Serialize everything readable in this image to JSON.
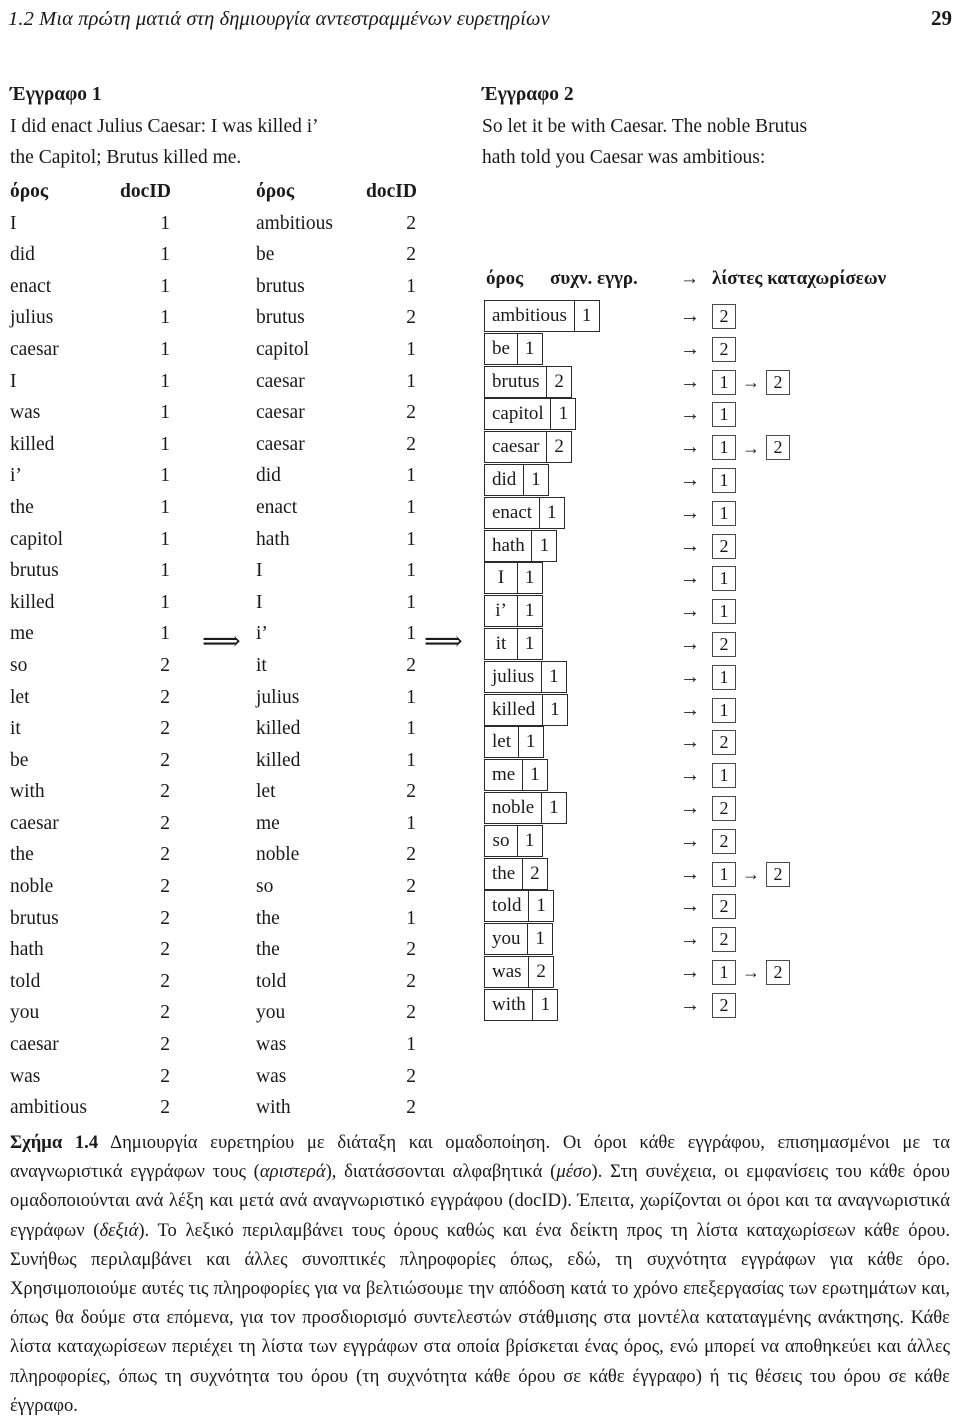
{
  "running_head": {
    "title": "1.2 Μια πρώτη ματιά στη δημιουργία αντεστραμμένων ευρετηρίων",
    "page_number": "29"
  },
  "documents": [
    {
      "title": "Έγγραφο 1",
      "line1": "I did enact Julius Caesar: I was killed i’",
      "line2": "the Capitol; Brutus killed me."
    },
    {
      "title": "Έγγραφο 2",
      "line1": "So let it be with Caesar. The noble Brutus",
      "line2": "hath told you Caesar was ambitious:"
    }
  ],
  "tables": {
    "headers": {
      "term": "όρος",
      "docid": "docID"
    },
    "unsorted": [
      {
        "term": "I",
        "docid": "1"
      },
      {
        "term": "did",
        "docid": "1"
      },
      {
        "term": "enact",
        "docid": "1"
      },
      {
        "term": "julius",
        "docid": "1"
      },
      {
        "term": "caesar",
        "docid": "1"
      },
      {
        "term": "I",
        "docid": "1"
      },
      {
        "term": "was",
        "docid": "1"
      },
      {
        "term": "killed",
        "docid": "1"
      },
      {
        "term": "i’",
        "docid": "1"
      },
      {
        "term": "the",
        "docid": "1"
      },
      {
        "term": "capitol",
        "docid": "1"
      },
      {
        "term": "brutus",
        "docid": "1"
      },
      {
        "term": "killed",
        "docid": "1"
      },
      {
        "term": "me",
        "docid": "1"
      },
      {
        "term": "so",
        "docid": "2"
      },
      {
        "term": "let",
        "docid": "2"
      },
      {
        "term": "it",
        "docid": "2"
      },
      {
        "term": "be",
        "docid": "2"
      },
      {
        "term": "with",
        "docid": "2"
      },
      {
        "term": "caesar",
        "docid": "2"
      },
      {
        "term": "the",
        "docid": "2"
      },
      {
        "term": "noble",
        "docid": "2"
      },
      {
        "term": "brutus",
        "docid": "2"
      },
      {
        "term": "hath",
        "docid": "2"
      },
      {
        "term": "told",
        "docid": "2"
      },
      {
        "term": "you",
        "docid": "2"
      },
      {
        "term": "caesar",
        "docid": "2"
      },
      {
        "term": "was",
        "docid": "2"
      },
      {
        "term": "ambitious",
        "docid": "2"
      }
    ],
    "sorted": [
      {
        "term": "ambitious",
        "docid": "2"
      },
      {
        "term": "be",
        "docid": "2"
      },
      {
        "term": "brutus",
        "docid": "1"
      },
      {
        "term": "brutus",
        "docid": "2"
      },
      {
        "term": "capitol",
        "docid": "1"
      },
      {
        "term": "caesar",
        "docid": "1"
      },
      {
        "term": "caesar",
        "docid": "2"
      },
      {
        "term": "caesar",
        "docid": "2"
      },
      {
        "term": "did",
        "docid": "1"
      },
      {
        "term": "enact",
        "docid": "1"
      },
      {
        "term": "hath",
        "docid": "1"
      },
      {
        "term": "I",
        "docid": "1"
      },
      {
        "term": "I",
        "docid": "1"
      },
      {
        "term": "i’",
        "docid": "1"
      },
      {
        "term": "it",
        "docid": "2"
      },
      {
        "term": "julius",
        "docid": "1"
      },
      {
        "term": "killed",
        "docid": "1"
      },
      {
        "term": "killed",
        "docid": "1"
      },
      {
        "term": "let",
        "docid": "2"
      },
      {
        "term": "me",
        "docid": "1"
      },
      {
        "term": "noble",
        "docid": "2"
      },
      {
        "term": "so",
        "docid": "2"
      },
      {
        "term": "the",
        "docid": "1"
      },
      {
        "term": "the",
        "docid": "2"
      },
      {
        "term": "told",
        "docid": "2"
      },
      {
        "term": "you",
        "docid": "2"
      },
      {
        "term": "was",
        "docid": "1"
      },
      {
        "term": "was",
        "docid": "2"
      },
      {
        "term": "with",
        "docid": "2"
      }
    ]
  },
  "arrows": {
    "double_arrow_glyph": "⟹",
    "single_arrow_glyph": "→"
  },
  "dictionary": {
    "headers": {
      "term": "όρος",
      "freq": "συχν. εγγρ.",
      "arrow": "→",
      "postings": "λίστες καταχωρίσεων"
    },
    "rows": [
      {
        "term": "ambitious",
        "freq": "1",
        "postings": [
          "2"
        ]
      },
      {
        "term": "be",
        "freq": "1",
        "postings": [
          "2"
        ]
      },
      {
        "term": "brutus",
        "freq": "2",
        "postings": [
          "1",
          "2"
        ]
      },
      {
        "term": "capitol",
        "freq": "1",
        "postings": [
          "1"
        ]
      },
      {
        "term": "caesar",
        "freq": "2",
        "postings": [
          "1",
          "2"
        ]
      },
      {
        "term": "did",
        "freq": "1",
        "postings": [
          "1"
        ]
      },
      {
        "term": "enact",
        "freq": "1",
        "postings": [
          "1"
        ]
      },
      {
        "term": "hath",
        "freq": "1",
        "postings": [
          "2"
        ]
      },
      {
        "term": "I",
        "freq": "1",
        "postings": [
          "1"
        ]
      },
      {
        "term": "i’",
        "freq": "1",
        "postings": [
          "1"
        ]
      },
      {
        "term": "it",
        "freq": "1",
        "postings": [
          "2"
        ]
      },
      {
        "term": "julius",
        "freq": "1",
        "postings": [
          "1"
        ]
      },
      {
        "term": "killed",
        "freq": "1",
        "postings": [
          "1"
        ]
      },
      {
        "term": "let",
        "freq": "1",
        "postings": [
          "2"
        ]
      },
      {
        "term": "me",
        "freq": "1",
        "postings": [
          "1"
        ]
      },
      {
        "term": "noble",
        "freq": "1",
        "postings": [
          "2"
        ]
      },
      {
        "term": "so",
        "freq": "1",
        "postings": [
          "2"
        ]
      },
      {
        "term": "the",
        "freq": "2",
        "postings": [
          "1",
          "2"
        ]
      },
      {
        "term": "told",
        "freq": "1",
        "postings": [
          "2"
        ]
      },
      {
        "term": "you",
        "freq": "1",
        "postings": [
          "2"
        ]
      },
      {
        "term": "was",
        "freq": "2",
        "postings": [
          "1",
          "2"
        ]
      },
      {
        "term": "with",
        "freq": "1",
        "postings": [
          "2"
        ]
      }
    ]
  },
  "caption": {
    "label": "Σχήμα 1.4",
    "parts": [
      {
        "text": "Δημιουργία ευρετηρίου με διάταξη και ομαδοποίηση. Οι όροι κάθε εγγράφου, επισημασμένοι με τα αναγνωριστικά εγγράφων τους (",
        "italic": false
      },
      {
        "text": "αριστερά",
        "italic": true
      },
      {
        "text": "), διατάσσονται αλφαβητικά (",
        "italic": false
      },
      {
        "text": "μέσο",
        "italic": true
      },
      {
        "text": "). Στη συνέχεια, οι εμφανίσεις του κάθε όρου ομαδοποιούνται ανά λέξη και μετά ανά αναγνωριστικό εγγράφου (docID). Έπειτα, χωρίζονται οι όροι και τα αναγνωριστικά εγγράφων (",
        "italic": false
      },
      {
        "text": "δεξιά",
        "italic": true
      },
      {
        "text": "). Το λεξικό περιλαμβάνει τους όρους καθώς και ένα δείκτη προς τη λίστα καταχωρίσεων κάθε όρου. Συνήθως περιλαμβάνει και άλλες συνοπτικές πληροφορίες όπως, εδώ, τη συχνότητα εγγράφων για κάθε όρο. Χρησιμοποιούμε αυτές τις πληροφορίες για να βελτιώσουμε την απόδοση κατά το χρόνο επεξεργασίας των ερωτημάτων και, όπως θα δούμε στα επόμενα, για τον προσδιορισμό συντελεστών στάθμισης στα μοντέλα καταταγμένης ανάκτησης. Κάθε λίστα καταχωρίσεων περιέχει τη λίστα των εγγράφων στα οποία βρίσκεται ένας όρος, ενώ μπορεί να αποθηκεύει και άλλες πληροφορίες, όπως τη συχνότητα του όρου (τη συχνότητα κάθε όρου σε κάθε έγγραφο) ή τις θέσεις του όρου σε κάθε έγγραφο.",
        "italic": false
      }
    ]
  }
}
